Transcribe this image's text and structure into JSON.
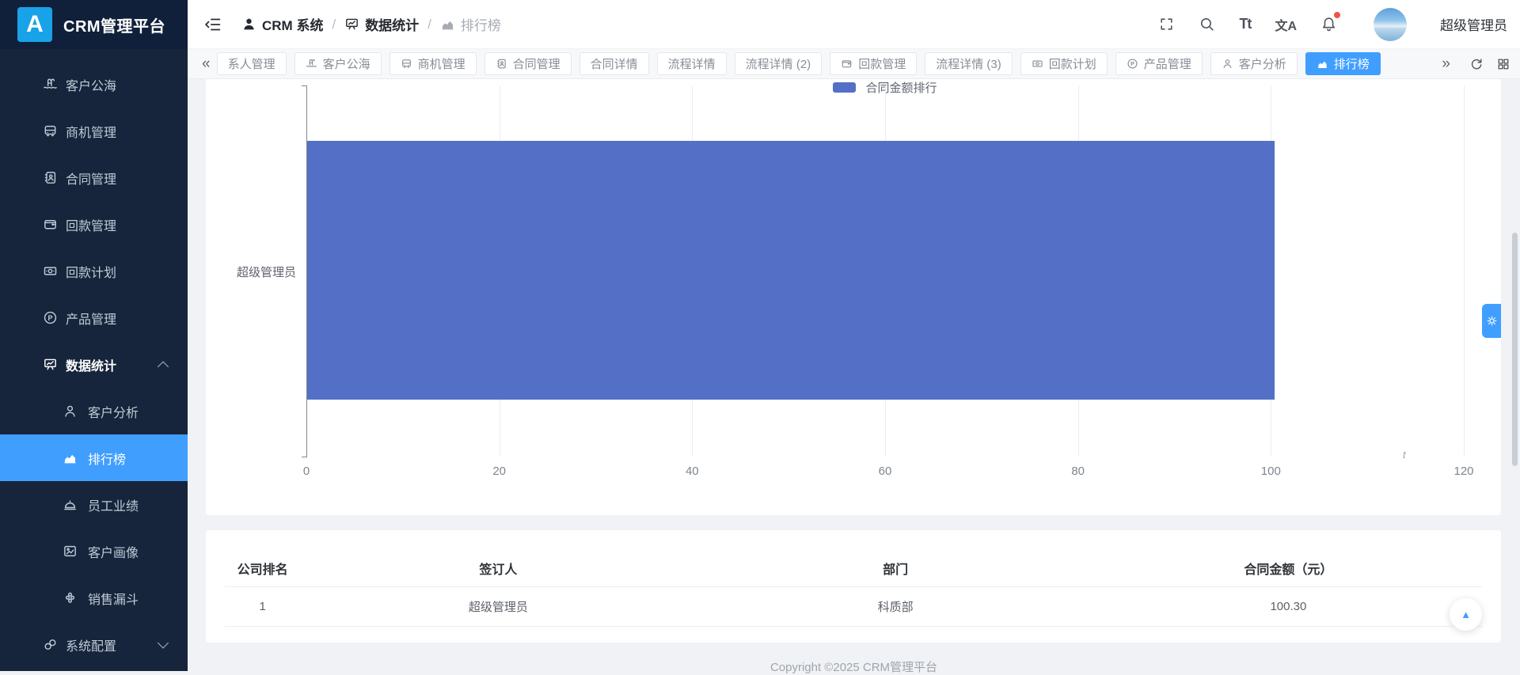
{
  "colors": {
    "accent": "#409eff",
    "bar": "#5470c6",
    "sidebar_bg": "#16253b",
    "logo_bg": "#18a3e9",
    "content_bg": "#f0f2f5"
  },
  "app": {
    "logo_letter": "A",
    "title": "CRM管理平台"
  },
  "header": {
    "breadcrumb": [
      {
        "label": "CRM 系统",
        "icon": "user-filled",
        "current": false
      },
      {
        "label": "数据统计",
        "icon": "board",
        "current": false
      },
      {
        "label": "排行榜",
        "icon": "chart",
        "current": true
      }
    ],
    "separator": "/",
    "fontsize_label": "Tt",
    "translate_label": "文A",
    "has_notification": true,
    "username": "超级管理员"
  },
  "sidebar": {
    "items": [
      {
        "id": "customer-pool",
        "label": "客户公海",
        "icon": "pool",
        "level": 1
      },
      {
        "id": "business",
        "label": "商机管理",
        "icon": "bus",
        "level": 1
      },
      {
        "id": "contract",
        "label": "合同管理",
        "icon": "contacts",
        "level": 1
      },
      {
        "id": "receivable",
        "label": "回款管理",
        "icon": "wallet",
        "level": 1
      },
      {
        "id": "receivable-plan",
        "label": "回款计划",
        "icon": "money",
        "level": 1
      },
      {
        "id": "product",
        "label": "产品管理",
        "icon": "product",
        "level": 1
      },
      {
        "id": "statistics",
        "label": "数据统计",
        "icon": "board",
        "level": 1,
        "expandable": true,
        "expanded": true
      },
      {
        "id": "customer-analysis",
        "label": "客户分析",
        "icon": "user",
        "level": 2
      },
      {
        "id": "ranking",
        "label": "排行榜",
        "icon": "chart",
        "level": 2,
        "active": true
      },
      {
        "id": "employee-performance",
        "label": "员工业绩",
        "icon": "performance",
        "level": 2
      },
      {
        "id": "customer-portrait",
        "label": "客户画像",
        "icon": "portrait",
        "level": 2
      },
      {
        "id": "sales-funnel",
        "label": "销售漏斗",
        "icon": "funnel",
        "level": 2
      },
      {
        "id": "system-config",
        "label": "系统配置",
        "icon": "link",
        "level": 1,
        "expandable": true,
        "expanded": false
      }
    ]
  },
  "tabbar": {
    "scroll_left": "«",
    "scroll_right": "»",
    "tabs": [
      {
        "id": "contact-management",
        "label": "系人管理"
      },
      {
        "id": "customer-pool",
        "label": "客户公海",
        "icon": "pool"
      },
      {
        "id": "business",
        "label": "商机管理",
        "icon": "bus"
      },
      {
        "id": "contract",
        "label": "合同管理",
        "icon": "contacts"
      },
      {
        "id": "contract-detail",
        "label": "合同详情"
      },
      {
        "id": "process-detail",
        "label": "流程详情"
      },
      {
        "id": "process-detail-2",
        "label": "流程详情 (2)"
      },
      {
        "id": "receivable",
        "label": "回款管理",
        "icon": "wallet"
      },
      {
        "id": "process-detail-3",
        "label": "流程详情 (3)"
      },
      {
        "id": "receivable-plan",
        "label": "回款计划",
        "icon": "money"
      },
      {
        "id": "product",
        "label": "产品管理",
        "icon": "product"
      },
      {
        "id": "customer-analysis",
        "label": "客户分析",
        "icon": "user"
      },
      {
        "id": "ranking",
        "label": "排行榜",
        "icon": "chart",
        "active": true
      }
    ]
  },
  "chart_data": {
    "type": "bar",
    "orientation": "horizontal",
    "legend": [
      "合同金额排行"
    ],
    "legend_position": "top-center",
    "categories": [
      "超级管理员"
    ],
    "values": [
      100.3
    ],
    "xlim": [
      0,
      120
    ],
    "xticks": [
      0,
      20,
      40,
      60,
      80,
      100,
      120
    ],
    "axis_name": "t",
    "grid": true,
    "series_color": "#5470c6"
  },
  "table": {
    "columns": [
      "公司排名",
      "签订人",
      "部门",
      "合同金额（元）"
    ],
    "rows": [
      [
        "1",
        "超级管理员",
        "科质部",
        "100.30"
      ]
    ]
  },
  "footer": {
    "copyright": "Copyright ©2025 CRM管理平台"
  },
  "floating": {
    "back_to_top": "▲"
  }
}
